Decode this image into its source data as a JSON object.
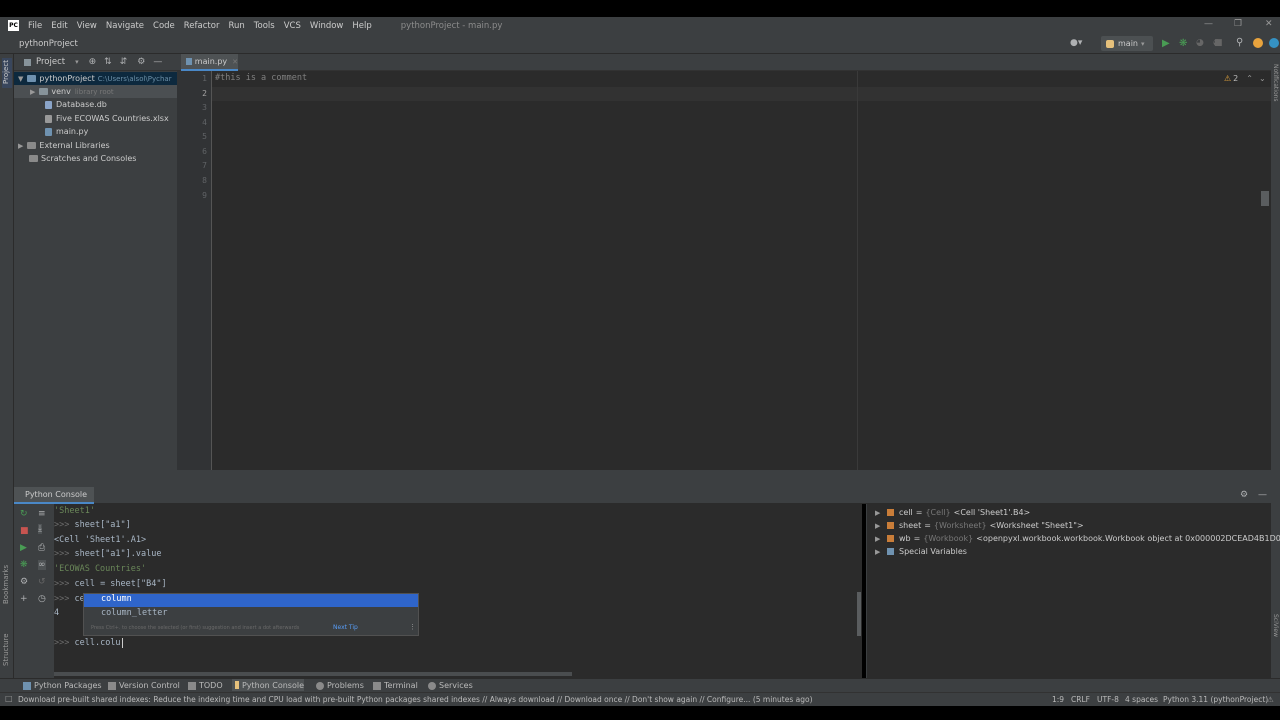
{
  "menubar": {
    "items": [
      "File",
      "Edit",
      "View",
      "Navigate",
      "Code",
      "Refactor",
      "Run",
      "Tools",
      "VCS",
      "Window",
      "Help"
    ],
    "title": "pythonProject - main.py"
  },
  "navbar": {
    "breadcrumb": "pythonProject",
    "branch": "main"
  },
  "project": {
    "header": "Project",
    "root_name": "pythonProject",
    "root_path": "C:\\Users\\alsol\\Pychar",
    "venv_name": "venv",
    "venv_hint": "library root",
    "files": [
      "Database.db",
      "Five ECOWAS Countries.xlsx",
      "main.py"
    ],
    "external_libraries": "External Libraries",
    "scratches": "Scratches and Consoles"
  },
  "editor": {
    "tab_label": "main.py",
    "line_numbers": [
      "1",
      "2",
      "3",
      "4",
      "5",
      "6",
      "7",
      "8",
      "9"
    ],
    "line1": "#this is a comment",
    "warnings": "2"
  },
  "console": {
    "title": "Python Console",
    "line1": "'Sheet1'",
    "line2_code": "sheet[\"a1\"]",
    "line3": "<Cell 'Sheet1'.A1>",
    "line4_code": "sheet[\"a1\"].value",
    "line5": "'ECOWAS Countries'",
    "line6_code": "cell = sheet[\"B4\"]",
    "line7_code": "ce",
    "line8": "4",
    "prompt": ">>>",
    "current_input": "cell.colu"
  },
  "autocomplete": {
    "items": [
      "column",
      "column_letter"
    ],
    "hint": "Press Ctrl+. to choose the selected (or first) suggestion and insert a dot afterwards",
    "next_tip": "Next Tip"
  },
  "variables": [
    {
      "name": "cell",
      "type": "{Cell}",
      "value": "<Cell 'Sheet1'.B4>"
    },
    {
      "name": "sheet",
      "type": "{Worksheet}",
      "value": "<Worksheet \"Sheet1\">"
    },
    {
      "name": "wb",
      "type": "{Workbook}",
      "value": "<openpyxl.workbook.workbook.Workbook object at 0x000002DCEAD4B1D0>"
    }
  ],
  "special_variables": "Special Variables",
  "bottom_tabs": [
    "Python Packages",
    "Version Control",
    "TODO",
    "Python Console",
    "Problems",
    "Terminal",
    "Services"
  ],
  "status": {
    "message": "Download pre-built shared indexes: Reduce the indexing time and CPU load with pre-built Python packages shared indexes // Always download // Download once // Don't show again // Configure... (5 minutes ago)",
    "position": "1:9",
    "line_sep": "CRLF",
    "encoding": "UTF-8",
    "indent": "4 spaces",
    "interpreter": "Python 3.11 (pythonProject)"
  },
  "side_labels": {
    "project": "Project",
    "bookmarks": "Bookmarks",
    "structure": "Structure",
    "notifications": "Notifications",
    "sciview": "SciView"
  },
  "colors": {
    "accent": "#4a88c7",
    "comment": "#808080",
    "string": "#6a8759",
    "run_green": "#499c54"
  }
}
